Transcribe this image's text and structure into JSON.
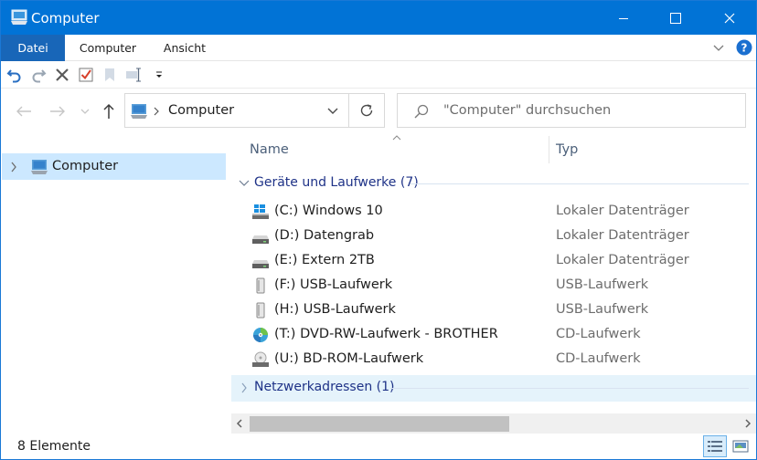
{
  "window": {
    "title": "Computer"
  },
  "ribbon": {
    "tabs": [
      {
        "label": "Datei",
        "active": true
      },
      {
        "label": "Computer",
        "active": false
      },
      {
        "label": "Ansicht",
        "active": false
      }
    ],
    "help_icon": "help-icon",
    "expand_icon": "chevron-down-icon"
  },
  "quick_access": {
    "items": [
      "undo-icon",
      "redo-icon",
      "delete-icon",
      "properties-icon",
      "new-folder-icon",
      "rename-icon",
      "customize-dropdown-icon"
    ]
  },
  "address": {
    "path": "Computer",
    "search_placeholder": "\"Computer\" durchsuchen"
  },
  "tree": {
    "items": [
      {
        "label": "Computer",
        "selected": true
      }
    ]
  },
  "columns": {
    "name": "Name",
    "type": "Typ"
  },
  "groups": [
    {
      "label": "Geräte und Laufwerke (7)",
      "expanded": true,
      "items": [
        {
          "name": "(C:) Windows 10",
          "type": "Lokaler Datenträger",
          "icon": "windows-drive-icon"
        },
        {
          "name": "(D:) Datengrab",
          "type": "Lokaler Datenträger",
          "icon": "hard-drive-icon"
        },
        {
          "name": "(E:) Extern 2TB",
          "type": "Lokaler Datenträger",
          "icon": "hard-drive-icon"
        },
        {
          "name": "(F:) USB-Laufwerk",
          "type": "USB-Laufwerk",
          "icon": "usb-drive-icon"
        },
        {
          "name": "(H:) USB-Laufwerk",
          "type": "USB-Laufwerk",
          "icon": "usb-drive-icon"
        },
        {
          "name": "(T:) DVD-RW-Laufwerk - BROTHER",
          "type": "CD-Laufwerk",
          "icon": "dvd-drive-icon"
        },
        {
          "name": "(U:) BD-ROM-Laufwerk",
          "type": "CD-Laufwerk",
          "icon": "cd-drive-icon"
        }
      ]
    },
    {
      "label": "Netzwerkadressen (1)",
      "expanded": false,
      "items": []
    }
  ],
  "status": {
    "count": "8 Elemente"
  },
  "colors": {
    "titlebar": "#0173d6",
    "active_tab": "#1866b8",
    "selection": "#cce8ff",
    "group_text": "#1e3287"
  }
}
